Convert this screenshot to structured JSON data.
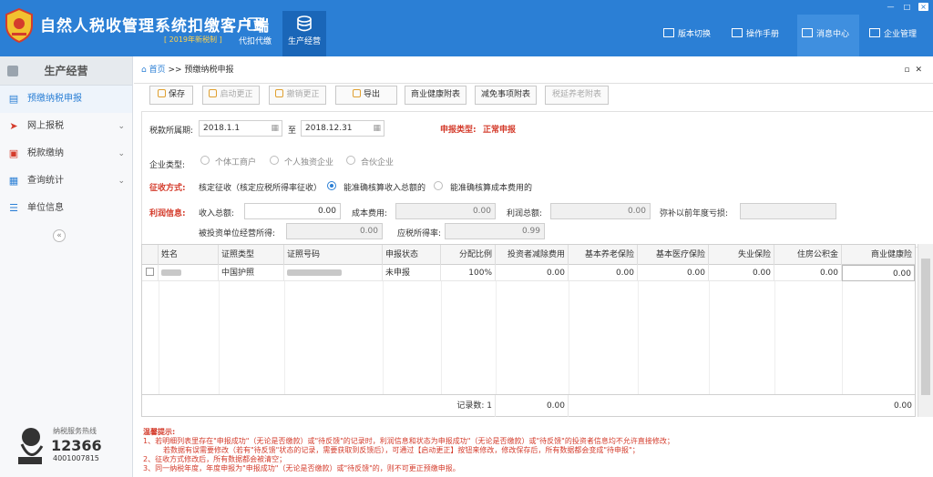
{
  "header": {
    "title": "自然人税收管理系统扣缴客户端",
    "subtitle": "[ 2019年新税制 ]",
    "nav": [
      {
        "label": "代扣代缴",
        "icon": "wallet-icon"
      },
      {
        "label": "生产经营",
        "icon": "coins-icon"
      }
    ],
    "tools": [
      {
        "label": "版本切换",
        "icon": "version-icon"
      },
      {
        "label": "操作手册",
        "icon": "manual-icon"
      },
      {
        "label": "消息中心",
        "icon": "mail-icon"
      },
      {
        "label": "企业管理",
        "icon": "building-icon"
      }
    ]
  },
  "sidebar": {
    "title": "生产经营",
    "items": [
      {
        "label": "预缴纳税申报",
        "icon": "clipboard-icon"
      },
      {
        "label": "网上报税",
        "icon": "send-icon"
      },
      {
        "label": "税款缴纳",
        "icon": "pay-icon"
      },
      {
        "label": "查询统计",
        "icon": "chart-icon"
      },
      {
        "label": "单位信息",
        "icon": "list-icon"
      }
    ],
    "hotline_label": "纳税服务热线",
    "hotline_number": "12366",
    "hotline_phone": "4001007815"
  },
  "breadcrumb": {
    "home": "首页",
    "sep": ">>",
    "current": "预缴纳税申报"
  },
  "toolbar": {
    "save": "保存",
    "start_correction": "启动更正",
    "cancel_correction": "撤销更正",
    "export": "导出",
    "commercial_health": "商业健康附表",
    "tax_exemption": "减免事项附表",
    "tax_deferred_pension": "税延养老附表"
  },
  "form": {
    "period_label": "税款所属期:",
    "period_start": "2018.1.1",
    "period_to": "至",
    "period_end": "2018.12.31",
    "declare_type_label": "申报类型:",
    "declare_type_value": "正常申报",
    "enterprise_type_label": "企业类型:",
    "enterprise_types": [
      "个体工商户",
      "个人独资企业",
      "合伙企业"
    ],
    "collection_label": "征收方式:",
    "collection_value": "核定征收（核定应税所得率征收）",
    "collection_options": [
      "能准确核算收入总额的",
      "能准确核算成本费用的"
    ],
    "profit_label": "利润信息:",
    "income_label": "收入总额:",
    "income_value": "0.00",
    "cost_label": "成本费用:",
    "cost_value": "0.00",
    "profit_total_label": "利润总额:",
    "profit_total_value": "0.00",
    "prior_loss_label": "弥补以前年度亏损:",
    "prior_loss_value": "",
    "investee_label": "被投资单位经营所得:",
    "investee_value": "0.00",
    "tax_rate_label": "应税所得率:",
    "tax_rate_value": "0.99"
  },
  "grid": {
    "columns": [
      "姓名",
      "证照类型",
      "证照号码",
      "申报状态",
      "分配比例",
      "投资者减除费用",
      "基本养老保险",
      "基本医疗保险",
      "失业保险",
      "住房公积金",
      "商业健康险"
    ],
    "rows": [
      {
        "id_type": "中国护照",
        "status": "未申报",
        "ratio": "100%",
        "deduction": "0.00",
        "pension": "0.00",
        "medical": "0.00",
        "unemployment": "0.00",
        "housing": "0.00",
        "health": "0.00"
      }
    ],
    "footer": {
      "count_label": "记录数:",
      "count": "1",
      "sum_deduction": "0.00",
      "sum_health": "0.00"
    }
  },
  "tips": {
    "title": "温馨提示:",
    "lines": [
      "1、若明细列表里存在\"申报成功\"（无论是否缴款）或\"待反馈\"的记录时，利润信息和状态为申报成功\"（无论是否缴款）或\"待反馈\"的投资者信息均不允许直接修改；",
      "若数据有误需要修改（若有\"待反馈\"状态的记录，需要获取到反馈后），可通过【启动更正】按钮来修改，修改保存后，所有数据都会变成\"待申报\"；",
      "2、征收方式修改后，所有数据都会被清空；",
      "3、同一纳税年度，年度申报为\"申报成功\"（无论是否缴款）或\"待反馈\"的，则不可更正预缴申报。"
    ]
  },
  "colors": {
    "header_blue": "#2b7fd5",
    "tip_red": "#d43c2c"
  }
}
